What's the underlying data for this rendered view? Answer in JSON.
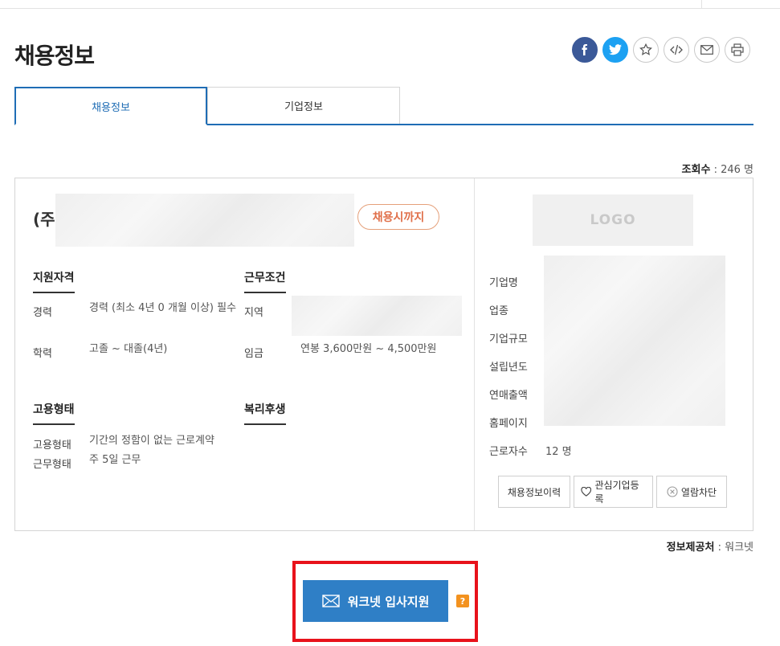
{
  "page": {
    "title": "채용정보"
  },
  "share": {
    "icons": [
      "facebook-icon",
      "twitter-icon",
      "star-icon",
      "embed-code-icon",
      "mail-icon",
      "print-icon"
    ]
  },
  "tabs": [
    {
      "label": "채용정보",
      "active": true
    },
    {
      "label": "기업정보",
      "active": false
    }
  ],
  "views": {
    "label": "조회수",
    "value": "246 명"
  },
  "job": {
    "company_prefix": "(주",
    "deadline_badge": "채용시까지",
    "qualifications": {
      "title": "지원자격",
      "rows": [
        {
          "label": "경력",
          "value": "경력 (최소 4년 0 개월 이상) 필수"
        },
        {
          "label": "학력",
          "value": "고졸 ~ 대졸(4년)"
        }
      ]
    },
    "conditions": {
      "title": "근무조건",
      "rows": [
        {
          "label": "지역",
          "value": ""
        },
        {
          "label": "임금",
          "value": "연봉 3,600만원 ~ 4,500만원"
        }
      ]
    },
    "employment": {
      "title": "고용형태",
      "rows": [
        {
          "label": "고용형태",
          "value": "기간의 정함이 없는 근로계약"
        },
        {
          "label": "근무형태",
          "value": "주 5일 근무"
        }
      ]
    },
    "benefits": {
      "title": "복리후생"
    }
  },
  "company": {
    "logo_text": "LOGO",
    "rows": [
      {
        "label": "기업명",
        "value": ""
      },
      {
        "label": "업종",
        "value": ""
      },
      {
        "label": "기업규모",
        "value": ""
      },
      {
        "label": "설립년도",
        "value": ""
      },
      {
        "label": "연매출액",
        "value": ""
      },
      {
        "label": "홈페이지",
        "value": ""
      },
      {
        "label": "근로자수",
        "value": "12 명"
      }
    ],
    "buttons": {
      "history": "채용정보이력",
      "favorite": "관심기업등록",
      "block": "열람차단"
    }
  },
  "source": {
    "label": "정보제공처",
    "value": "워크넷"
  },
  "apply": {
    "label": "워크넷 입사지원",
    "help": "?"
  },
  "colors": {
    "accent": "#1f6db5",
    "apply": "#2f7fc6",
    "badge": "#e0704a",
    "highlight": "#e8121b"
  }
}
